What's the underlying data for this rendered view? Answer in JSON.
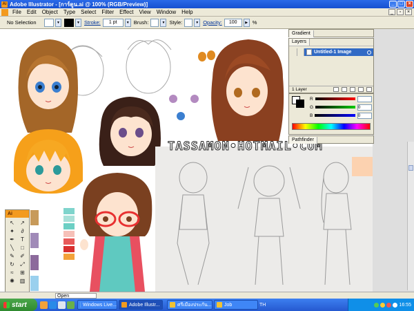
{
  "window": {
    "title": "Adobe Illustrator - [การ์ตูน.ai @ 100% (RGB/Preview)]"
  },
  "menu": [
    "File",
    "Edit",
    "Object",
    "Type",
    "Select",
    "Filter",
    "Effect",
    "View",
    "Window",
    "Help"
  ],
  "control": {
    "selection": "No Selection",
    "stroke_label": "Stroke:",
    "stroke_value": "1 pt",
    "brush_label": "Brush:",
    "style_label": "Style:",
    "opacity_label": "Opacity:",
    "opacity_value": "100",
    "opacity_unit": "%"
  },
  "panels": {
    "gradient_tab": "Gradient",
    "layers_tab": "Layers",
    "layer_name": "Untitled-1 Image",
    "layer_count": "1 Layer",
    "color": {
      "r_label": "R",
      "g_label": "G",
      "b_label": "B",
      "r_value": "",
      "g_value": "0",
      "b_value": "0"
    },
    "pathfinder_tab": "Pathfinder"
  },
  "watermark": "TASSAMON•HOTMAIL•COM",
  "tools": {
    "logo": "Ai"
  },
  "status": {
    "open_label": "Open"
  },
  "taskbar": {
    "start": "start",
    "tasks": [
      "Windows Live...",
      "Adobe Illustr...",
      "ศรีเมืองประกัน...",
      "Job"
    ],
    "lang": "TH",
    "clock": "16:55"
  },
  "colors": {
    "title_bar": "#1650d0",
    "chrome": "#ece9d8",
    "selection": "#316ac5",
    "illustrator_orange": "#f39a1e",
    "swatches_left": [
      "#c79a5a",
      "#ffffff",
      "#a08ab8",
      "#ffffff",
      "#8c6a9c",
      "#9ad0ee"
    ],
    "swatches_mid": [
      "#7fd4cc",
      "#a8e0d8",
      "#6ccfc4",
      "#f6c0b8",
      "#e85a5a",
      "#d83030",
      "#f3a23a"
    ]
  }
}
